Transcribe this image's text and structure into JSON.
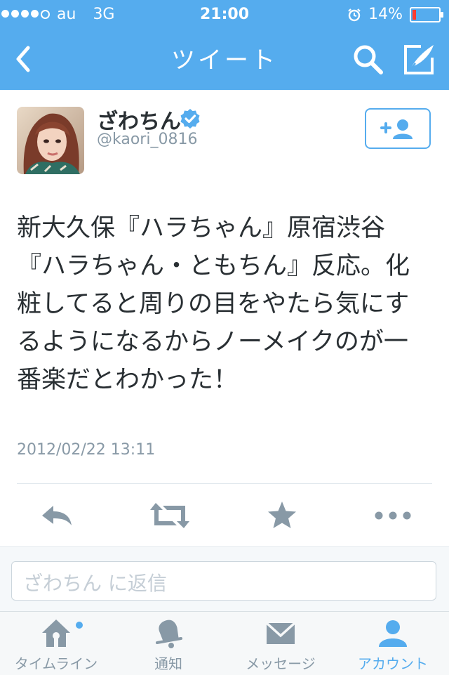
{
  "status": {
    "carrier": "au",
    "network": "3G",
    "time": "21:00",
    "battery": "14%",
    "battery_level": 0.14,
    "battery_color": "#ff3b30"
  },
  "nav": {
    "title": "ツイート",
    "back_icon": "chevron-left-icon",
    "search_icon": "search-icon",
    "compose_icon": "compose-icon"
  },
  "profile": {
    "name": "ざわちん",
    "handle": "@kaori_0816",
    "verified": true,
    "follow_icon": "add-user-icon"
  },
  "tweet": {
    "text": "新大久保『ハラちゃん』原宿渋谷『ハラちゃん・ともちん』反応。化粧してると周りの目をやたら気にするようになるからノーメイクのが一番楽だとわかった！",
    "timestamp": "2012/02/22 13:11"
  },
  "actions": [
    "reply-icon",
    "retweet-icon",
    "favorite-star-icon",
    "more-icon"
  ],
  "reply": {
    "placeholder": "ざわちん に返信"
  },
  "tabs": [
    {
      "label": "タイムライン",
      "icon": "home-icon",
      "active": false,
      "badge": true
    },
    {
      "label": "通知",
      "icon": "bell-icon",
      "active": false
    },
    {
      "label": "メッセージ",
      "icon": "envelope-icon",
      "active": false
    },
    {
      "label": "アカウント",
      "icon": "person-icon",
      "active": true
    }
  ],
  "colors": {
    "accent": "#55acee",
    "icon_gray": "#8899a6",
    "text": "#292f33"
  }
}
